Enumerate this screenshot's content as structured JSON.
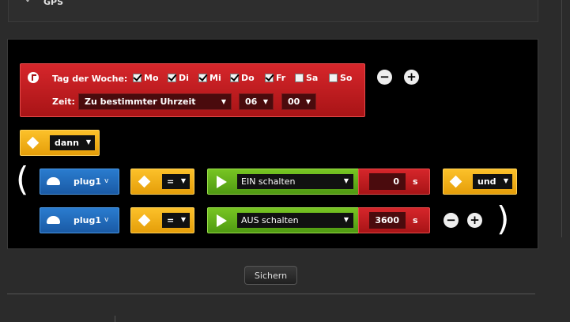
{
  "header": {
    "gps_label": "GPS"
  },
  "condition": {
    "weekday_label": "Tag der Woche:",
    "days": [
      {
        "label": "Mo",
        "checked": true
      },
      {
        "label": "Di",
        "checked": true
      },
      {
        "label": "Mi",
        "checked": true
      },
      {
        "label": "Do",
        "checked": true
      },
      {
        "label": "Fr",
        "checked": true
      },
      {
        "label": "Sa",
        "checked": false
      },
      {
        "label": "So",
        "checked": false
      }
    ],
    "time_label": "Zeit:",
    "time_mode": "Zu bestimmter Uhrzeit",
    "hour": "06",
    "minute": "00",
    "remove_label": "−",
    "add_label": "+"
  },
  "then_block": {
    "label": "dann"
  },
  "actions": [
    {
      "device": "plug1",
      "operator": "=",
      "action": "EIN schalten",
      "duration": "0",
      "unit": "s",
      "connector": "und"
    },
    {
      "device": "plug1",
      "operator": "=",
      "action": "AUS schalten",
      "duration": "3600",
      "unit": "s",
      "remove_label": "−",
      "add_label": "+"
    }
  ],
  "footer": {
    "save_label": "Sichern"
  },
  "colors": {
    "condition_red": "#c21c1f",
    "yellow": "#f2ae16",
    "blue": "#2a6fbf",
    "green": "#66b21a"
  }
}
